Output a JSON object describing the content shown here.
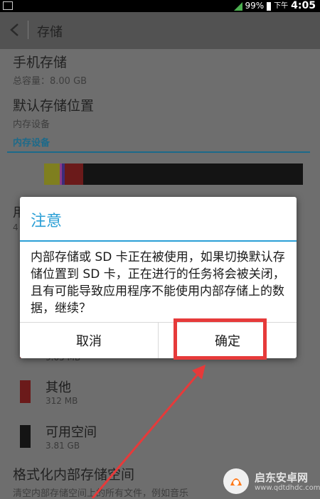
{
  "status_bar": {
    "battery": "99%",
    "ampm": "下午",
    "time": "4:05"
  },
  "action_bar": {
    "title": "存储",
    "back_icon": "chevron-left-icon"
  },
  "settings": {
    "phone_storage": {
      "title": "手机存储",
      "summary": "总容量：8.00 GB"
    },
    "default_location": {
      "title": "默认存储位置",
      "summary": "内存设备"
    },
    "section_header": "内存设备",
    "partial_row_1": "用",
    "partial_row_1_sub": "4",
    "storage_segments": [
      {
        "color": "#7f7f1f",
        "fraction": 0.06
      },
      {
        "color": "#8a3b8a",
        "fraction": 0.008
      },
      {
        "color": "#3d2c7a",
        "fraction": 0.012
      },
      {
        "color": "#6b1a1a",
        "fraction": 0.07
      }
    ],
    "legend": [
      {
        "title": "",
        "size": "9.05 MB",
        "color": "#6b1a1a"
      },
      {
        "title": "其他",
        "size": "312 MB",
        "color": "#6b1a1a"
      },
      {
        "title": "可用空间",
        "size": "3.81 GB",
        "color": "#141414"
      }
    ],
    "format": {
      "title": "格式化内部存储空间",
      "summary": "清空内部存储空间上的所有文件，例如音乐"
    }
  },
  "dialog": {
    "title": "注意",
    "message": "内部存储或 SD 卡正在被使用，如果切换默认存储位置到 SD 卡，正在进行的任务将会被关闭，且有可能导致应用程序不能使用内部存储上的数据，继续？",
    "cancel_label": "取消",
    "ok_label": "确定"
  },
  "watermark": {
    "name": "启东安卓网",
    "url": "www.qdtdhdc.com"
  },
  "colors": {
    "dialog_accent": "#2a9fd6",
    "highlight": "#e63a3a",
    "section_accent": "#1c6a8a"
  }
}
